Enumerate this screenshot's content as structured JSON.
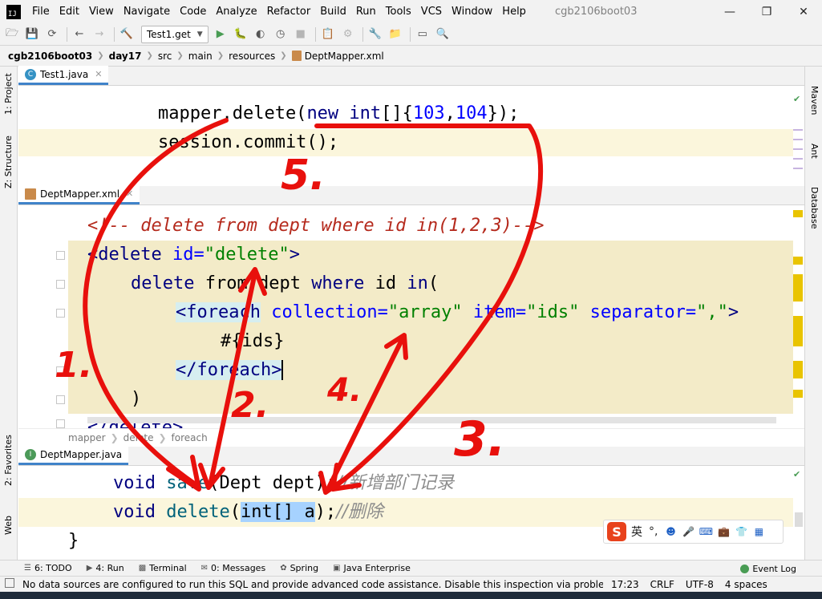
{
  "menu": {
    "items": [
      "File",
      "Edit",
      "View",
      "Navigate",
      "Code",
      "Analyze",
      "Refactor",
      "Build",
      "Run",
      "Tools",
      "VCS",
      "Window",
      "Help"
    ],
    "project_title": "cgb2106boot03"
  },
  "toolbar": {
    "run_config": "Test1.get"
  },
  "navbar": {
    "crumbs": [
      "cgb2106boot03",
      "day17",
      "src",
      "main",
      "resources",
      "DeptMapper.xml"
    ]
  },
  "left_stripe": {
    "project": "1: Project",
    "structure": "Z: Structure",
    "favorites": "2: Favorites",
    "web": "Web"
  },
  "right_stripe": {
    "maven": "Maven",
    "ant": "Ant",
    "database": "Database"
  },
  "tabs": {
    "top": "Test1.java",
    "middle": "DeptMapper.xml",
    "bottom": "DeptMapper.java"
  },
  "code_top": {
    "line1_pre": "mapper.delete(",
    "line1_kw": "new int",
    "line1_mid": "[]{",
    "line1_n1": "103",
    "line1_comma": ",",
    "line1_n2": "104",
    "line1_end": "});",
    "line2": "session.commit();"
  },
  "code_xml": {
    "comment": "<!-- delete from dept where id in(1,2,3)-->",
    "open_tag": "delete",
    "open_attr": "id",
    "open_val": "\"delete\"",
    "sql_a": "delete",
    "sql_b": " from dept ",
    "sql_c": "where",
    "sql_d": " id ",
    "sql_e": "in",
    "sql_f": "(",
    "foreach_open": "<foreach",
    "collection_attr": "collection",
    "collection_val": "\"array\"",
    "item_attr": "item",
    "item_val": "\"ids\"",
    "sep_attr": "separator",
    "sep_val": "\",\"",
    "foreach_gt": ">",
    "param": "#{ids}",
    "foreach_close": "</foreach>",
    "close_paren": ")",
    "close_tag": "</delete>"
  },
  "breadcrumb2": {
    "items": [
      "mapper",
      "delete",
      "foreach"
    ]
  },
  "code_java": {
    "l1_kw": "void",
    "l1_fn": "save",
    "l1_args": "(Dept dept);",
    "l1_comment": "//新增部门记录",
    "l2_kw": "void",
    "l2_fn": "delete",
    "l2_open": "(",
    "l2_sel": "int[] a",
    "l2_close": ");",
    "l2_comment": "//删除",
    "l3": "}"
  },
  "annotations": {
    "n1": "1.",
    "n2": "2.",
    "n3": "3.",
    "n4": "4.",
    "n5": "5."
  },
  "ime": {
    "logo": "S",
    "lang": "英",
    "punct": "°,"
  },
  "tool_tabs": {
    "todo": "6: TODO",
    "run": "4: Run",
    "terminal": "Terminal",
    "messages": "0: Messages",
    "spring": "Spring",
    "java_ee": "Java Enterprise",
    "event_log": "Event Log"
  },
  "status": {
    "message": "No data sources are configured to run this SQL and provide advanced code assistance. Disable this inspection via problem me...",
    "position": "17:23",
    "line_sep": "CRLF",
    "encoding": "UTF-8",
    "indent": "4 spaces"
  },
  "colors": {
    "annotation_red": "#e8100c",
    "accent_blue": "#4083c9",
    "highlight_yellow": "#fbf6dc"
  }
}
